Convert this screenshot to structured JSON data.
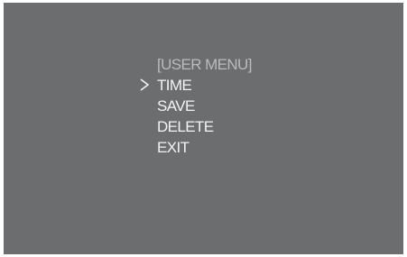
{
  "menu": {
    "title": "[USER MENU]",
    "selected_index": 0,
    "items": [
      {
        "label": "TIME"
      },
      {
        "label": "SAVE"
      },
      {
        "label": "DELETE"
      },
      {
        "label": "EXIT"
      }
    ]
  },
  "colors": {
    "background": "#6b6d6f",
    "title": "#b9bbbd",
    "item": "#f2f3f3"
  },
  "icons": {
    "cursor": "chevron-right-icon"
  }
}
